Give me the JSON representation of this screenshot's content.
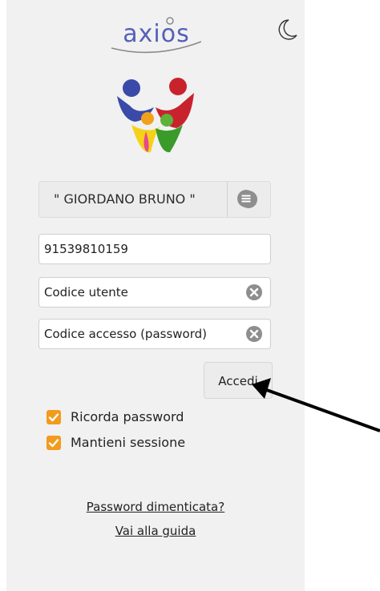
{
  "brand": {
    "logo_text": "axios"
  },
  "school": {
    "selected": "\" GIORDANO BRUNO \""
  },
  "form": {
    "school_code_value": "91539810159",
    "user_code_placeholder": "Codice utente",
    "password_placeholder": "Codice accesso (password)",
    "submit_label": "Accedi"
  },
  "options": [
    {
      "label": "Ricorda password",
      "checked": true
    },
    {
      "label": "Mantieni sessione",
      "checked": true
    }
  ],
  "links": {
    "forgot": "Password dimenticata?",
    "guide": "Vai alla guida"
  },
  "icons": {
    "theme": "moon-icon",
    "dropdown": "chevron-down-icon",
    "menu": "menu-icon",
    "clear": "clear-icon",
    "checkbox": "checkmark-icon"
  },
  "colors": {
    "accent": "#f29b1d",
    "panel": "#f1f1f1",
    "brand_purple": "#3a4aa8"
  }
}
